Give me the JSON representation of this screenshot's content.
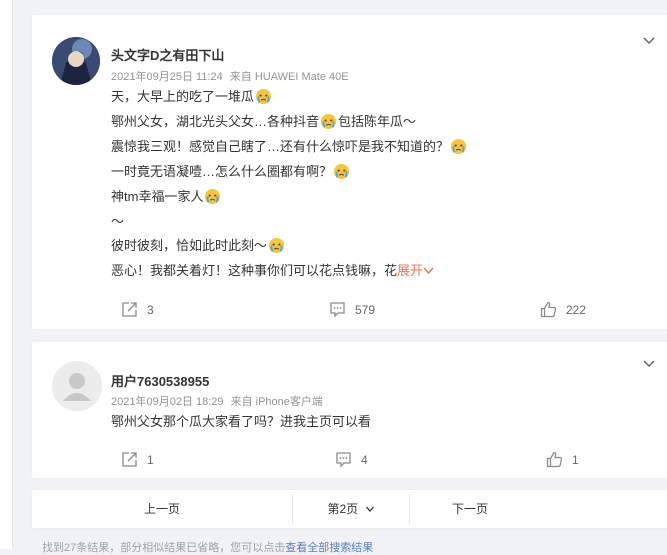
{
  "comments": [
    {
      "user": "头文字D之有田下山",
      "time": "2021年09月25日 11:24",
      "source": "来自 HUAWEI Mate 40E",
      "lines": [
        {
          "text": "天，大早上的吃了一堆瓜"
        },
        {
          "text": "鄂州父女，湖北光头父女…各种抖音",
          "after": "包括陈年瓜～"
        },
        {
          "text": "震惊我三观！感觉自己瞎了…还有什么惊吓是我不知道的？"
        },
        {
          "text": "一时竟无语凝噎…怎么什么圈都有啊？"
        },
        {
          "text": "神tm幸福一家人"
        },
        {
          "text": "～"
        },
        {
          "text": "彼时彼刻，恰如此时此刻～"
        },
        {
          "text": "恶心！我都关着灯！这种事你们可以花点钱嘛，花"
        }
      ],
      "expand_label": "展开",
      "shares": "3",
      "comments": "579",
      "likes": "222"
    },
    {
      "user": "用户7630538955",
      "time": "2021年09月02日 18:29",
      "source": "来自 iPhone客户端",
      "lines": [
        {
          "text": "鄂州父女那个瓜大家看了吗？进我主页可以看"
        }
      ],
      "shares": "1",
      "comments": "4",
      "likes": "1"
    }
  ],
  "pagination": {
    "prev": "上一页",
    "current": "第2页",
    "next": "下一页"
  },
  "footer_note": {
    "text": "找到27条结果，部分相似结果已省略，您可以点击",
    "link": "查看全部搜索结果"
  },
  "colors": {
    "accent": "#eb7350",
    "background": "#f1f2f5",
    "meta_text": "#939393"
  }
}
